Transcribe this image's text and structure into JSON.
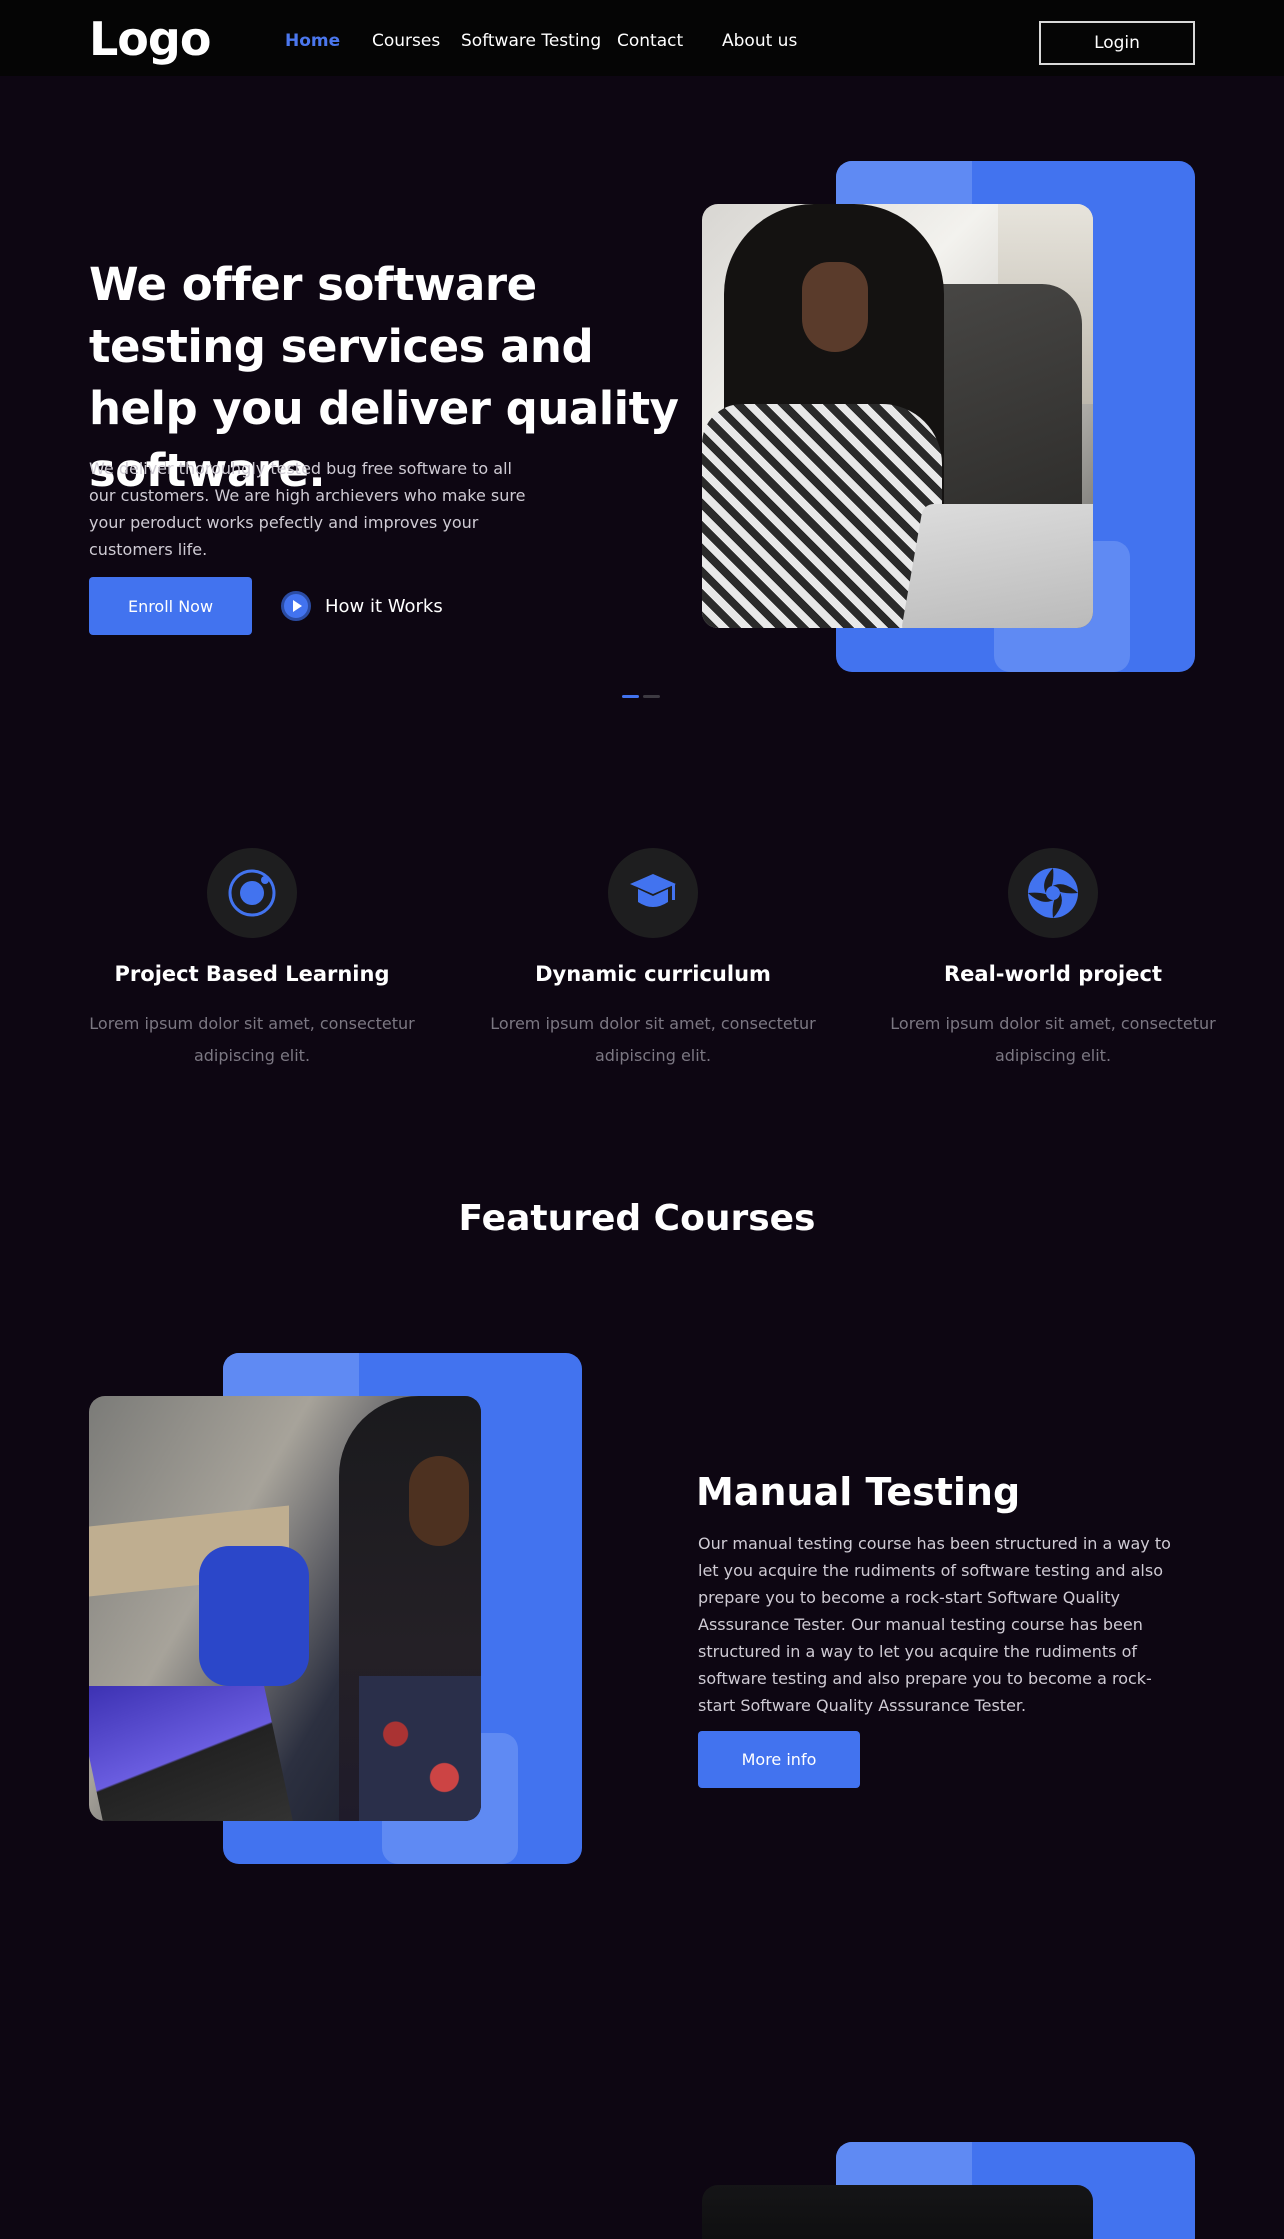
{
  "nav": {
    "logo": "Logo",
    "links": [
      "Home",
      "Courses",
      "Software Testing",
      "Contact",
      "About us"
    ],
    "login": "Login"
  },
  "hero": {
    "title": "We offer software testing services and help you deliver quality software.",
    "description": "We deliver thorouhgly tested bug free software to all our customers. We are high archievers who make sure your peroduct works pefectly and improves your customers life.",
    "enroll": "Enroll Now",
    "how_it_works": "How it Works"
  },
  "features": [
    {
      "icon": "target-icon",
      "title": "Project Based Learning",
      "desc": "Lorem ipsum dolor sit amet, consectetur adipiscing elit."
    },
    {
      "icon": "graduation-cap-icon",
      "title": "Dynamic curriculum",
      "desc": "Lorem ipsum dolor sit amet, consectetur adipiscing elit."
    },
    {
      "icon": "aperture-icon",
      "title": "Real-world project",
      "desc": "Lorem ipsum dolor sit amet, consectetur adipiscing elit."
    }
  ],
  "featured": {
    "title": "Featured Courses"
  },
  "course": {
    "title": "Manual Testing",
    "description": "Our manual testing course has been structured in a way to let you acquire the rudiments of software testing and also prepare you to become a rock-start Software Quality Asssurance Tester. Our manual testing course has been structured in a way to let you acquire the rudiments of software testing and also prepare you to become a rock-start Software Quality Asssurance Tester.",
    "more": "More info"
  },
  "colors": {
    "accent": "#4273ef",
    "background": "#0d0612",
    "navbar": "#050505"
  }
}
